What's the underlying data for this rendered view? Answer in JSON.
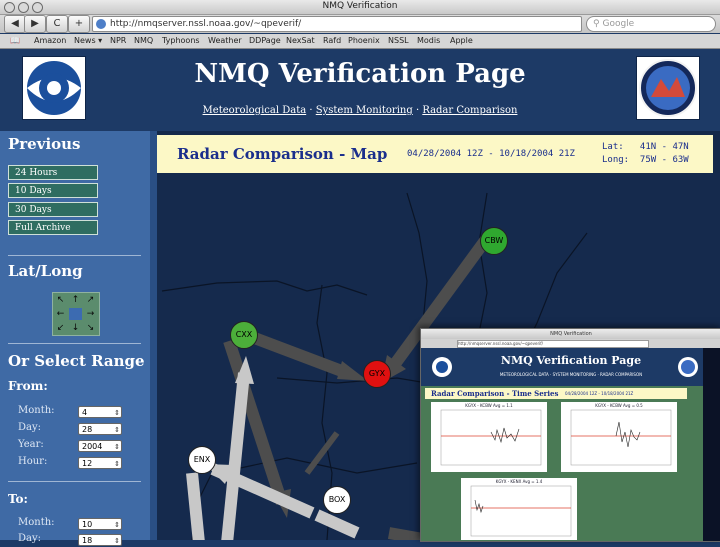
{
  "browser": {
    "window_title": "NMQ Verification",
    "url": "http://nmqserver.nssl.noaa.gov/~qpeverif/",
    "search_placeholder": "Google",
    "back": "◀",
    "forward": "▶",
    "reload": "C",
    "add": "+",
    "bookmarks": [
      "Amazon",
      "News ▾",
      "NPR",
      "NMQ",
      "Typhoons",
      "Weather",
      "DDPage",
      "NexSat",
      "Rafd",
      "Phoenix",
      "NSSL",
      "Modis",
      "Apple"
    ]
  },
  "page": {
    "title": "NMQ Verification Page",
    "nav": [
      "Meteorological Data",
      "System Monitoring",
      "Radar Comparison"
    ],
    "nav_sep": "·"
  },
  "sidebar": {
    "previous_heading": "Previous",
    "periods": [
      "24 Hours",
      "10 Days",
      "30 Days",
      "Full Archive"
    ],
    "latlong_heading": "Lat/Long",
    "range_heading": "Or Select Range",
    "from_label": "From:",
    "to_label": "To:",
    "from_fields": [
      {
        "label": "Month:",
        "value": "4"
      },
      {
        "label": "Day:",
        "value": "28"
      },
      {
        "label": "Year:",
        "value": "2004"
      },
      {
        "label": "Hour:",
        "value": "12"
      }
    ],
    "to_fields": [
      {
        "label": "Month:",
        "value": "10"
      },
      {
        "label": "Day:",
        "value": "18"
      }
    ]
  },
  "radar": {
    "title": "Radar Comparison - Map",
    "dates": "04/28/2004 12Z - 10/18/2004 21Z",
    "lat": "Lat:   41N - 47N",
    "long": "Long:  75W - 63W",
    "stations": [
      {
        "id": "CBW",
        "color": "#2fa82f"
      },
      {
        "id": "CXX",
        "color": "#4caf3a"
      },
      {
        "id": "GYX",
        "color": "#e01010"
      },
      {
        "id": "ENX",
        "color": "#ffffff"
      },
      {
        "id": "BOX",
        "color": "#ffffff"
      }
    ]
  },
  "overlay": {
    "window_title": "NMQ Verification",
    "url": "http://nmqserver.nssl.noaa.gov/~qpeverif/",
    "title": "NMQ Verification Page",
    "nav": "METEOROLOGICAL DATA · SYSTEM MONITORING · RADAR COMPARISON",
    "panel_title": "Radar Comparison - Time Series",
    "panel_dates": "04/28/2004 12Z - 10/18/2004 21Z",
    "charts": [
      {
        "caption": "KGYX - KCBW    Avg = 1.1"
      },
      {
        "caption": "KGYX - KCBW    Avg = 0.5"
      },
      {
        "caption": "KGYX - KENX    Avg = 1.4"
      }
    ]
  },
  "colors": {
    "page_bg": "#1d3a66",
    "sidebar_bg": "#3f6aa5",
    "period_btn": "#2f6d61",
    "header_panel": "#fcf8c6",
    "arrow": "#4d4d4d",
    "arrow_light": "#c8c8c8"
  }
}
